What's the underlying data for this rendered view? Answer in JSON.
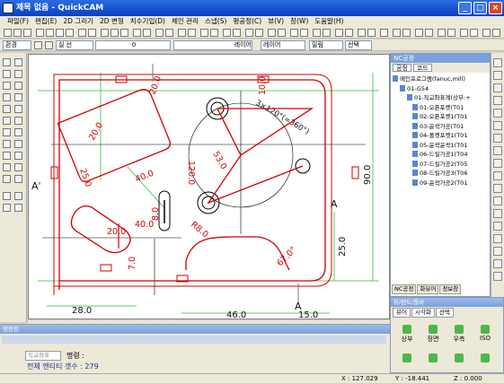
{
  "window": {
    "title": "제목 없음 - QuickCAM",
    "min": "_",
    "max": "□",
    "close": "×"
  },
  "menu": [
    "파일(F)",
    "편집(E)",
    "2D 그리기",
    "2D 변형",
    "치수기입(D)",
    "체인 관리",
    "스냅(S)",
    "평공정(C)",
    "뷰(V)",
    "창(W)",
    "도움말(H)"
  ],
  "toolbar2": {
    "env_label": "환경",
    "linestyle_label": "실 선",
    "width_value": "0",
    "layer_label": "레이어",
    "layer_value": "레이어",
    "ortho_label": "밀림",
    "select_label": "선택"
  },
  "drawing": {
    "dims": {
      "left_v": "25.0",
      "hole_r": "20.0",
      "pocket_a": "25.0",
      "pocket_b": "40.0",
      "slot": "20.0",
      "slot2": "20.0",
      "r8": "R8.0",
      "small8": "8.0",
      "v7": "7.0",
      "angle40": "40.0",
      "bolt_circle": "3×120°(=360°)",
      "h120": "120.0",
      "h53": "53.0",
      "h30": "30.0",
      "top10": "10.0",
      "r8b": "R8.0",
      "ang67": "67.0°",
      "right90": "90.0",
      "right25": "25.0",
      "b28": "28.0",
      "b46": "46.0",
      "b15": "15.0",
      "section_a1": "A",
      "section_a2": "A'",
      "section_a3": "A"
    }
  },
  "nc_panel": {
    "title": "NC공정",
    "tabs": [
      "공정",
      "코드"
    ],
    "tree": [
      {
        "label": "메인프로그램(fanuc,mill)",
        "level": 0
      },
      {
        "label": "01-G54",
        "level": 1
      },
      {
        "label": "01-직교좌표계(상부:+",
        "level": 2
      },
      {
        "label": "01-오픈포켓(T01",
        "level": 3
      },
      {
        "label": "02-오픈포켓1(T01",
        "level": 3
      },
      {
        "label": "03-윤곽가공(T01",
        "level": 3
      },
      {
        "label": "04-폴켓포켓1(T01",
        "level": 3
      },
      {
        "label": "05-윤곽윤곽1(T01",
        "level": 3
      },
      {
        "label": "06-드릴가공1(T04",
        "level": 3
      },
      {
        "label": "07-드릴가공2(T05",
        "level": 3
      },
      {
        "label": "08-드릴가공3(T06",
        "level": 3
      },
      {
        "label": "09-윤곽가공2(T01",
        "level": 3
      }
    ],
    "bottom_tabs": [
      "NC공정",
      "화뷰어",
      "정보창"
    ]
  },
  "command": {
    "title": "명령창",
    "combo_placeholder": "직교좌표",
    "prompt": "명령 :",
    "result": "전체 엔티티 갯수 : 279"
  },
  "view_panel": {
    "title": "뷰/편도/툴바",
    "tabs": [
      "뷰어",
      "시각화",
      "선택"
    ],
    "buttons": [
      "상부",
      "정면",
      "우측",
      "ISO"
    ]
  },
  "status": {
    "x": "X : 127.029",
    "y": "Y : -18.441",
    "z": "Z : 0.000"
  }
}
